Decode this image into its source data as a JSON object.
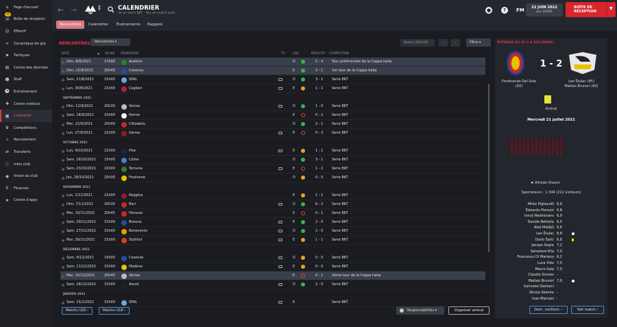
{
  "sidebar": {
    "items": [
      {
        "label": "Page d'accueil",
        "icon": "home-icon"
      },
      {
        "label": "Boîte de réception",
        "icon": "inbox-icon",
        "badge": "10"
      },
      {
        "label": "Effectif",
        "icon": "squad-icon"
      },
      {
        "label": "Dynamique de grp.",
        "icon": "dynamics-icon"
      },
      {
        "label": "Tactiques",
        "icon": "tactics-icon"
      },
      {
        "label": "Centre des données",
        "icon": "data-icon"
      },
      {
        "label": "Staff",
        "icon": "staff-icon"
      },
      {
        "label": "Entraînement",
        "icon": "training-icon"
      },
      {
        "label": "Centre médical",
        "icon": "medical-icon"
      },
      {
        "label": "Calendrier",
        "icon": "calendar-icon",
        "active": true
      },
      {
        "label": "Compétitions",
        "icon": "trophy-icon"
      },
      {
        "label": "Recrutement",
        "icon": "scouting-icon"
      },
      {
        "label": "Transferts",
        "icon": "transfer-icon"
      },
      {
        "label": "Infos club",
        "icon": "club-info-icon"
      },
      {
        "label": "Vision du club",
        "icon": "vision-icon"
      },
      {
        "label": "Finances",
        "icon": "finance-icon"
      },
      {
        "label": "Centre d'appr.",
        "icon": "dev-centre-icon"
      }
    ]
  },
  "header": {
    "title": "CALENDRIER",
    "subtitle": "3e en Serie BKT · Pas de match prév.",
    "fm": "FM",
    "date": "22 JUIN 2022",
    "time": "Jeu 10h00",
    "continue_label": "BOÎTE DE RÉCEPTION"
  },
  "tabs": [
    "Rencontres",
    "Calendrier",
    "Événements",
    "Rappels"
  ],
  "main": {
    "section_title": "RENCONTRES",
    "view_dropdown": "Rencontres",
    "season": "Saison 2021/22",
    "filter": "Filtre",
    "columns": {
      "date": "DATE",
      "time": "HEURE",
      "opponent": "ADVERSAIRE",
      "tv": "TV",
      "venue": "LIEU",
      "result": "RÉSULTAT",
      "competition": "COMPÉTITION"
    },
    "months": {
      "sep": "SEPTEMBRE 2021",
      "oct": "OCTOBRE 2021",
      "nov": "NOVEMBRE 2021",
      "dec": "DÉCEMBRE 2021",
      "jan": "JANVIER 2022"
    },
    "fixtures": [
      {
        "date": "Dim, 8/8/2021",
        "time": "17h00",
        "opp": "Avellino",
        "tv": false,
        "venue": "D",
        "res": "W",
        "score": "5 - 4",
        "comp": "Tour préliminaire de la Coppa Italia",
        "hl": true,
        "crest": "#2e7d32"
      },
      {
        "date": "Dim, 15/8/2021",
        "time": "20h45",
        "opp": "Cosenza",
        "tv": false,
        "venue": "E",
        "res": "W",
        "score": "2 - 1",
        "comp": "1er tour de la Coppa Italia",
        "hl": true,
        "crest": "#1f4fa0"
      },
      {
        "date": "Sam, 21/8/2021",
        "time": "15h00",
        "opp": "SPAL",
        "tv": true,
        "venue": "D",
        "res": "W",
        "score": "3 - 1",
        "comp": "Serie BKT",
        "crest": "#6fa8dc"
      },
      {
        "date": "Lun, 30/8/2021",
        "time": "21h00",
        "opp": "Cagliari",
        "tv": true,
        "venue": "E",
        "res": "D",
        "score": "1 - 1",
        "comp": "Serie BKT",
        "crest": "#b71c3a"
      },
      {
        "date": "Dim, 12/9/2021",
        "time": "20h30",
        "opp": "Venise",
        "tv": true,
        "venue": "D",
        "res": "W",
        "score": "1 - 0",
        "comp": "Serie BKT",
        "crest": "#bbbbbb"
      },
      {
        "date": "Sam, 18/9/2021",
        "time": "15h00",
        "opp": "Parme",
        "tv": false,
        "venue": "E",
        "res": "L",
        "score": "0 - 2",
        "comp": "Serie BKT",
        "crest": "#f1f1f1"
      },
      {
        "date": "Mer, 22/9/2021",
        "time": "20h00",
        "opp": "Cittadella",
        "tv": false,
        "venue": "D",
        "res": "W",
        "score": "2 - 1",
        "comp": "Serie BKT",
        "crest": "#c62828"
      },
      {
        "date": "Lun, 27/9/2021",
        "time": "21h00",
        "opp": "Genoa",
        "tv": true,
        "venue": "E",
        "res": "L",
        "score": "0 - 3",
        "comp": "Serie BKT",
        "crest": "#8e1b1b"
      },
      {
        "date": "Lun, 4/10/2021",
        "time": "21h00",
        "opp": "Pise",
        "tv": true,
        "venue": "E",
        "res": "D",
        "score": "1 - 1",
        "comp": "Serie BKT",
        "crest": "#222244"
      },
      {
        "date": "Sam, 16/10/2021",
        "time": "15h00",
        "opp": "Côme",
        "tv": false,
        "venue": "D",
        "res": "W",
        "score": "3 - 1",
        "comp": "Serie BKT",
        "crest": "#4a7bd0"
      },
      {
        "date": "Sam, 23/10/2021",
        "time": "15h00",
        "opp": "Ternana",
        "tv": true,
        "venue": "E",
        "res": "L",
        "score": "1 - 2",
        "comp": "Serie BKT",
        "crest": "#2e7d32"
      },
      {
        "date": "Jeu, 28/10/2021",
        "time": "20h30",
        "opp": "Frosinone",
        "tv": false,
        "venue": "D",
        "res": "D",
        "score": "0 - 0",
        "comp": "Serie BKT",
        "crest": "#e6c200"
      },
      {
        "date": "Lun, 1/11/2021",
        "time": "21h00",
        "opp": "Reggina",
        "tv": false,
        "venue": "E",
        "res": "D",
        "score": "1 - 1",
        "comp": "Serie BKT",
        "crest": "#8e1b2a"
      },
      {
        "date": "Dim, 7/11/2021",
        "time": "20h30",
        "opp": "Bari",
        "tv": true,
        "venue": "D",
        "res": "W",
        "score": "6 - 2",
        "comp": "Serie BKT",
        "crest": "#c62828"
      },
      {
        "date": "Mer, 10/11/2021",
        "time": "20h45",
        "opp": "Pérouse",
        "tv": false,
        "venue": "E",
        "res": "L",
        "score": "0 - 1",
        "comp": "Serie BKT",
        "crest": "#c62828"
      },
      {
        "date": "Sam, 20/11/2021",
        "time": "15h00",
        "opp": "Brescia",
        "tv": true,
        "venue": "E",
        "res": "W",
        "score": "2 - 0",
        "comp": "Serie BKT",
        "crest": "#1f4fa0"
      },
      {
        "date": "Sam, 27/11/2021",
        "time": "15h00",
        "opp": "Benevento",
        "tv": true,
        "venue": "D",
        "res": "W",
        "score": "2 - 0",
        "comp": "Serie BKT",
        "crest": "#e6a100"
      },
      {
        "date": "Mar, 30/11/2021",
        "time": "21h00",
        "opp": "Südtirol",
        "tv": true,
        "venue": "E",
        "res": "D",
        "score": "1 - 1",
        "comp": "Serie BKT",
        "crest": "#d84315"
      },
      {
        "date": "Sam, 4/12/2021",
        "time": "15h00",
        "opp": "Cosenza",
        "tv": true,
        "venue": "D",
        "res": "D",
        "score": "0 - 0",
        "comp": "Serie BKT",
        "crest": "#1f4fa0"
      },
      {
        "date": "Sam, 11/12/2021",
        "time": "15h00",
        "opp": "Modène",
        "tv": true,
        "venue": "E",
        "res": "D",
        "score": "0 - 0",
        "comp": "Serie BKT",
        "crest": "#e6c200"
      },
      {
        "date": "Mer, 15/12/2021",
        "time": "20h45",
        "opp": "Venise",
        "tv": false,
        "venue": "E",
        "res": "L",
        "score": "0 - 1",
        "comp": "2ème tour de la Coppa Italia",
        "hl": true,
        "crest": "#bbbbbb"
      },
      {
        "date": "Sam, 18/12/2021",
        "time": "15h00",
        "opp": "Ascoli",
        "tv": true,
        "venue": "D",
        "res": "W",
        "score": "2 - 0",
        "comp": "Serie BKT",
        "crest": "#222222"
      },
      {
        "date": "Sam, 15/1/2022",
        "time": "15h00",
        "opp": "SPAL",
        "tv": true,
        "venue": "E",
        "res": "N",
        "score": "",
        "comp": "Serie BKT",
        "crest": "#6fa8dc"
      }
    ],
    "u20": "Matchs U20",
    "u18": "Matchs U18",
    "responsibilities": "Responsabilités",
    "friendly": "Organiser amical"
  },
  "right": {
    "title": "POTENZA (E) (IL Y A 338 JOURS)",
    "score": "1 - 2",
    "home_scorers": [
      "Ferdinando Del Sole",
      "(50)"
    ],
    "away_scorers": [
      "Leo Štulac (85)",
      "Matteo Brunori (90)"
    ],
    "comp": "Amical",
    "date": "Mercredi 21 juillet 2021",
    "referee": "Alfredo Viviani",
    "attendance": "Spectateurs : 1 344 (212 visiteurs)",
    "players": [
      {
        "n": "Mirko Pigliacelli",
        "r": "6,6",
        "ev": ""
      },
      {
        "n": "Edoardo Pierozzi",
        "r": "6,8",
        "ev": ""
      },
      {
        "n": "Ionuț Nedelcearu",
        "r": "6,9",
        "ev": ""
      },
      {
        "n": "Davide Bettella",
        "r": "6,5",
        "ev": ""
      },
      {
        "n": "Aleš Matějů",
        "r": "6,6",
        "ev": ""
      },
      {
        "n": "Leo Štulac",
        "r": "8,8",
        "ev": "goal"
      },
      {
        "n": "Dario Šarić",
        "r": "6,8",
        "ev": "yellow"
      },
      {
        "n": "Jacopo Segre",
        "r": "7,2",
        "ev": ""
      },
      {
        "n": "Salvatore Elia",
        "r": "7,0",
        "ev": ""
      },
      {
        "n": "Francesco Di Mariano",
        "r": "6,2",
        "ev": ""
      },
      {
        "n": "Luca Vido",
        "r": "7,0",
        "ev": ""
      },
      {
        "n": "Marco Sala",
        "r": "7,0",
        "ev": ""
      },
      {
        "n": "Claudio Gomes",
        "r": "-",
        "ev": ""
      },
      {
        "n": "Matteo Brunori",
        "r": "7,9",
        "ev": "goal"
      },
      {
        "n": "Samuele Damiani",
        "r": "-",
        "ev": ""
      },
      {
        "n": "Nicola Valente",
        "r": "-",
        "ev": ""
      },
      {
        "n": "Ivan Marconi",
        "r": "-",
        "ev": ""
      }
    ],
    "prev_btn": "Dern. confront.",
    "match_btn": "Voir match"
  }
}
